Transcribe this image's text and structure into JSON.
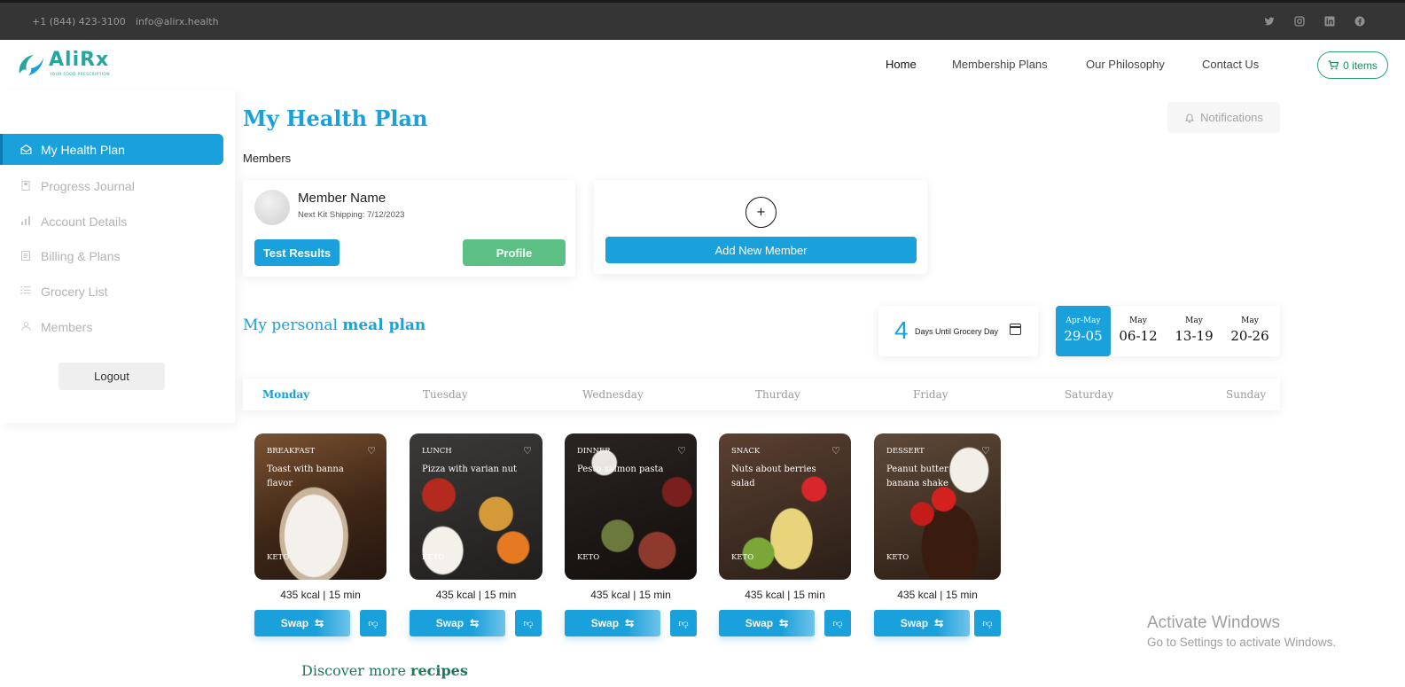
{
  "topbar": {
    "phone": "+1 (844) 423-3100",
    "email": "info@alirx.health",
    "social_icons": [
      "twitter-icon",
      "instagram-icon",
      "linkedin-icon",
      "facebook-icon"
    ]
  },
  "header": {
    "logo_text": "AliRx",
    "logo_tagline": "YOUR FOOD PRESCRIPTION",
    "nav": [
      {
        "label": "Home"
      },
      {
        "label": "Membership Plans"
      },
      {
        "label": "Our Philosophy"
      },
      {
        "label": "Contact Us"
      }
    ],
    "cart_label": "0 items"
  },
  "sidebar": {
    "items": [
      {
        "label": "My Health Plan",
        "icon": "envelope-open-icon"
      },
      {
        "label": "Progress Journal",
        "icon": "journal-icon"
      },
      {
        "label": "Account Details",
        "icon": "bar-chart-icon"
      },
      {
        "label": "Billing & Plans",
        "icon": "receipt-icon"
      },
      {
        "label": "Grocery List",
        "icon": "list-icon"
      },
      {
        "label": "Members",
        "icon": "user-icon"
      }
    ],
    "logout_label": "Logout"
  },
  "main": {
    "title": "My Health Plan",
    "notifications_label": "Notifications",
    "members_label": "Members",
    "member": {
      "name": "Member Name",
      "shipping": "Next Kit Shipping: 7/12/2023",
      "test_results_label": "Test Results",
      "profile_label": "Profile"
    },
    "add_member": {
      "plus": "+",
      "label": "Add New Member"
    },
    "meal_plan": {
      "title_prefix": "My personal",
      "title_bold": "meal plan"
    },
    "grocery": {
      "days": "4",
      "label": "Days Until Grocery Day"
    },
    "weeks": [
      {
        "month": "Apr-May",
        "days": "29-05"
      },
      {
        "month": "May",
        "days": "06-12"
      },
      {
        "month": "May",
        "days": "13-19"
      },
      {
        "month": "May",
        "days": "20-26"
      }
    ],
    "days": [
      "Monday",
      "Tuesday",
      "Wednesday",
      "Thurday",
      "Friday",
      "Saturday",
      "Sunday"
    ],
    "meals": [
      {
        "type": "BREAKFAST",
        "name": "Toast with banna flavor",
        "diet": "KETO",
        "stats": "435 kcal | 15 min"
      },
      {
        "type": "LUNCH",
        "name": "Pizza with varian nut",
        "diet": "KETO",
        "stats": "435 kcal | 15 min"
      },
      {
        "type": "DINNER",
        "name": "Pesto salmon pasta",
        "diet": "KETO",
        "stats": "435 kcal | 15 min"
      },
      {
        "type": "SNACK",
        "name": "Nuts about berries salad",
        "diet": "KETO",
        "stats": "435 kcal | 15 min"
      },
      {
        "type": "DESSERT",
        "name": "Peanut butter banana shake",
        "diet": "KETO",
        "stats": "435 kcal | 15 min"
      }
    ],
    "swap_label": "Swap",
    "discover_prefix": "Discover more",
    "discover_bold": "recipes"
  },
  "watermark": {
    "line1": "Activate Windows",
    "line2": "Go to Settings to activate Windows."
  },
  "colors": {
    "primary": "#1aa0da",
    "green": "#5cbf84",
    "topbar": "#353535"
  }
}
